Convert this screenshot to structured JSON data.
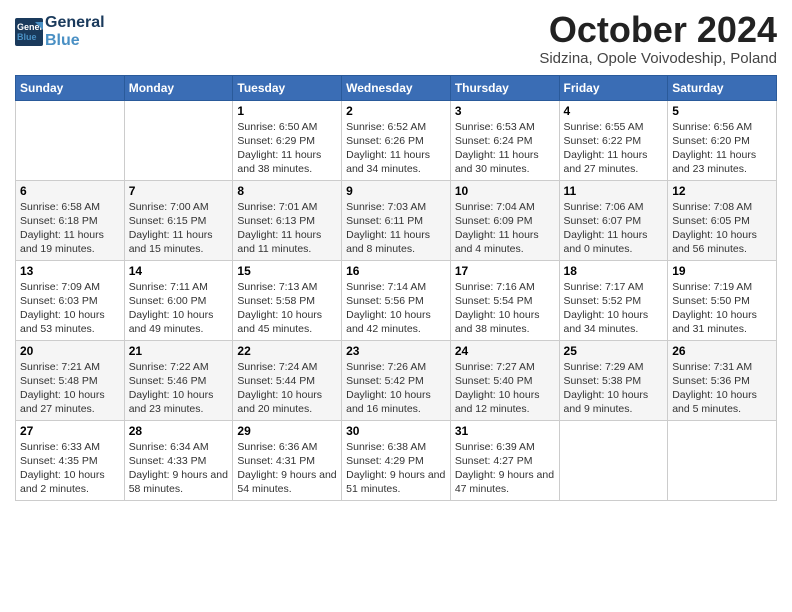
{
  "header": {
    "logo_line1": "General",
    "logo_line2": "Blue",
    "month_title": "October 2024",
    "location": "Sidzina, Opole Voivodeship, Poland"
  },
  "days_of_week": [
    "Sunday",
    "Monday",
    "Tuesday",
    "Wednesday",
    "Thursday",
    "Friday",
    "Saturday"
  ],
  "weeks": [
    [
      {
        "day": "",
        "info": ""
      },
      {
        "day": "",
        "info": ""
      },
      {
        "day": "1",
        "info": "Sunrise: 6:50 AM\nSunset: 6:29 PM\nDaylight: 11 hours and 38 minutes."
      },
      {
        "day": "2",
        "info": "Sunrise: 6:52 AM\nSunset: 6:26 PM\nDaylight: 11 hours and 34 minutes."
      },
      {
        "day": "3",
        "info": "Sunrise: 6:53 AM\nSunset: 6:24 PM\nDaylight: 11 hours and 30 minutes."
      },
      {
        "day": "4",
        "info": "Sunrise: 6:55 AM\nSunset: 6:22 PM\nDaylight: 11 hours and 27 minutes."
      },
      {
        "day": "5",
        "info": "Sunrise: 6:56 AM\nSunset: 6:20 PM\nDaylight: 11 hours and 23 minutes."
      }
    ],
    [
      {
        "day": "6",
        "info": "Sunrise: 6:58 AM\nSunset: 6:18 PM\nDaylight: 11 hours and 19 minutes."
      },
      {
        "day": "7",
        "info": "Sunrise: 7:00 AM\nSunset: 6:15 PM\nDaylight: 11 hours and 15 minutes."
      },
      {
        "day": "8",
        "info": "Sunrise: 7:01 AM\nSunset: 6:13 PM\nDaylight: 11 hours and 11 minutes."
      },
      {
        "day": "9",
        "info": "Sunrise: 7:03 AM\nSunset: 6:11 PM\nDaylight: 11 hours and 8 minutes."
      },
      {
        "day": "10",
        "info": "Sunrise: 7:04 AM\nSunset: 6:09 PM\nDaylight: 11 hours and 4 minutes."
      },
      {
        "day": "11",
        "info": "Sunrise: 7:06 AM\nSunset: 6:07 PM\nDaylight: 11 hours and 0 minutes."
      },
      {
        "day": "12",
        "info": "Sunrise: 7:08 AM\nSunset: 6:05 PM\nDaylight: 10 hours and 56 minutes."
      }
    ],
    [
      {
        "day": "13",
        "info": "Sunrise: 7:09 AM\nSunset: 6:03 PM\nDaylight: 10 hours and 53 minutes."
      },
      {
        "day": "14",
        "info": "Sunrise: 7:11 AM\nSunset: 6:00 PM\nDaylight: 10 hours and 49 minutes."
      },
      {
        "day": "15",
        "info": "Sunrise: 7:13 AM\nSunset: 5:58 PM\nDaylight: 10 hours and 45 minutes."
      },
      {
        "day": "16",
        "info": "Sunrise: 7:14 AM\nSunset: 5:56 PM\nDaylight: 10 hours and 42 minutes."
      },
      {
        "day": "17",
        "info": "Sunrise: 7:16 AM\nSunset: 5:54 PM\nDaylight: 10 hours and 38 minutes."
      },
      {
        "day": "18",
        "info": "Sunrise: 7:17 AM\nSunset: 5:52 PM\nDaylight: 10 hours and 34 minutes."
      },
      {
        "day": "19",
        "info": "Sunrise: 7:19 AM\nSunset: 5:50 PM\nDaylight: 10 hours and 31 minutes."
      }
    ],
    [
      {
        "day": "20",
        "info": "Sunrise: 7:21 AM\nSunset: 5:48 PM\nDaylight: 10 hours and 27 minutes."
      },
      {
        "day": "21",
        "info": "Sunrise: 7:22 AM\nSunset: 5:46 PM\nDaylight: 10 hours and 23 minutes."
      },
      {
        "day": "22",
        "info": "Sunrise: 7:24 AM\nSunset: 5:44 PM\nDaylight: 10 hours and 20 minutes."
      },
      {
        "day": "23",
        "info": "Sunrise: 7:26 AM\nSunset: 5:42 PM\nDaylight: 10 hours and 16 minutes."
      },
      {
        "day": "24",
        "info": "Sunrise: 7:27 AM\nSunset: 5:40 PM\nDaylight: 10 hours and 12 minutes."
      },
      {
        "day": "25",
        "info": "Sunrise: 7:29 AM\nSunset: 5:38 PM\nDaylight: 10 hours and 9 minutes."
      },
      {
        "day": "26",
        "info": "Sunrise: 7:31 AM\nSunset: 5:36 PM\nDaylight: 10 hours and 5 minutes."
      }
    ],
    [
      {
        "day": "27",
        "info": "Sunrise: 6:33 AM\nSunset: 4:35 PM\nDaylight: 10 hours and 2 minutes."
      },
      {
        "day": "28",
        "info": "Sunrise: 6:34 AM\nSunset: 4:33 PM\nDaylight: 9 hours and 58 minutes."
      },
      {
        "day": "29",
        "info": "Sunrise: 6:36 AM\nSunset: 4:31 PM\nDaylight: 9 hours and 54 minutes."
      },
      {
        "day": "30",
        "info": "Sunrise: 6:38 AM\nSunset: 4:29 PM\nDaylight: 9 hours and 51 minutes."
      },
      {
        "day": "31",
        "info": "Sunrise: 6:39 AM\nSunset: 4:27 PM\nDaylight: 9 hours and 47 minutes."
      },
      {
        "day": "",
        "info": ""
      },
      {
        "day": "",
        "info": ""
      }
    ]
  ]
}
